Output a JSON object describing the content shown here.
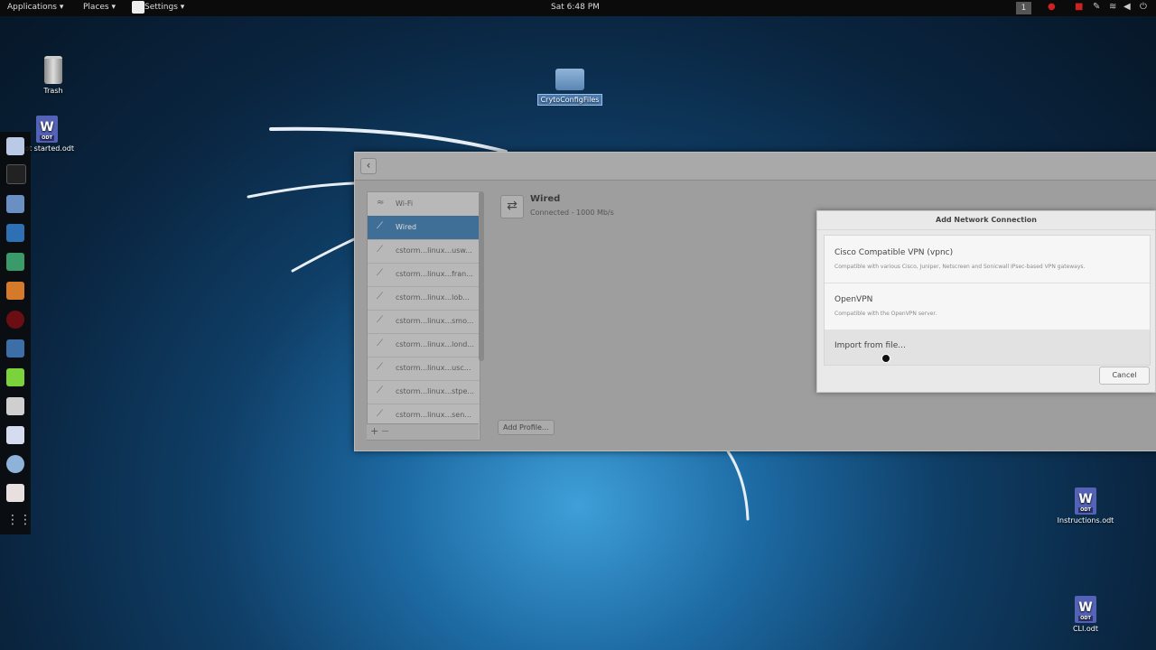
{
  "topbar": {
    "applications": "Applications ▾",
    "places": "Places ▾",
    "settings": "Settings ▾",
    "clock": "Sat  6:48 PM",
    "workspace": "1"
  },
  "desktop": {
    "trash": "Trash",
    "doc_left": "pot started.odt",
    "folder": "CrytoConfigFiles",
    "instructions": "Instructions.odt",
    "cli": "CLI.odt"
  },
  "settings_window": {
    "sidebar_items": [
      {
        "label": "Wi-Fi",
        "icon": "wifi-icon"
      },
      {
        "label": "Wired",
        "icon": "wired-icon"
      },
      {
        "label": "cstorm...linux...usw...",
        "icon": "vpn-icon"
      },
      {
        "label": "cstorm...linux...fran...",
        "icon": "vpn-icon"
      },
      {
        "label": "cstorm...linux...lob...",
        "icon": "vpn-icon"
      },
      {
        "label": "cstorm...linux...smo...",
        "icon": "vpn-icon"
      },
      {
        "label": "cstorm...linux...lond...",
        "icon": "vpn-icon"
      },
      {
        "label": "cstorm...linux...usc...",
        "icon": "vpn-icon"
      },
      {
        "label": "cstorm...linux...stpe...",
        "icon": "vpn-icon"
      },
      {
        "label": "cstorm...linux...sen...",
        "icon": "vpn-icon"
      }
    ],
    "wired_title": "Wired",
    "wired_status": "Connected - 1000 Mb/s",
    "add_profile": "Add Profile..."
  },
  "dialog": {
    "title": "Add Network Connection",
    "options": [
      {
        "title": "Cisco Compatible VPN (vpnc)",
        "subtitle": "Compatible with various Cisco, Juniper, Netscreen and Sonicwall IPsec-based VPN gateways."
      },
      {
        "title": "OpenVPN",
        "subtitle": "Compatible with the OpenVPN server."
      },
      {
        "title": "Import from file...",
        "subtitle": ""
      }
    ],
    "cancel": "Cancel"
  }
}
